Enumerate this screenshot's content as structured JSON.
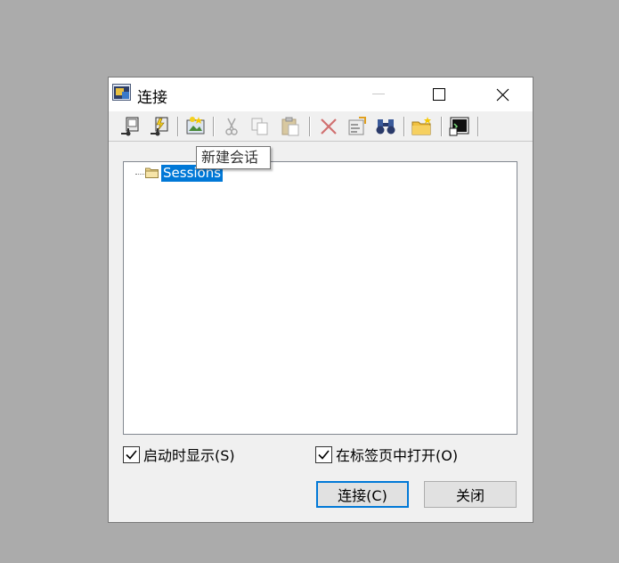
{
  "window": {
    "title": "连接"
  },
  "tooltip": {
    "text": "新建会话"
  },
  "toolbar": {
    "icons": [
      "connect-icon",
      "quick-connect-icon",
      "new-session-icon",
      "cut-icon",
      "copy-icon",
      "paste-icon",
      "delete-icon",
      "properties-icon",
      "find-icon",
      "new-folder-icon",
      "terminal-icon"
    ]
  },
  "tree": {
    "root_label": "Sessions"
  },
  "options": {
    "show_on_startup": {
      "label": "启动时显示(S)",
      "checked": true
    },
    "open_in_tab": {
      "label": "在标签页中打开(O)",
      "checked": true
    }
  },
  "buttons": {
    "connect": "连接(C)",
    "close": "关闭"
  },
  "colors": {
    "accent": "#0078d7",
    "backdrop": "#ababab",
    "dialog": "#f0f0f0"
  }
}
